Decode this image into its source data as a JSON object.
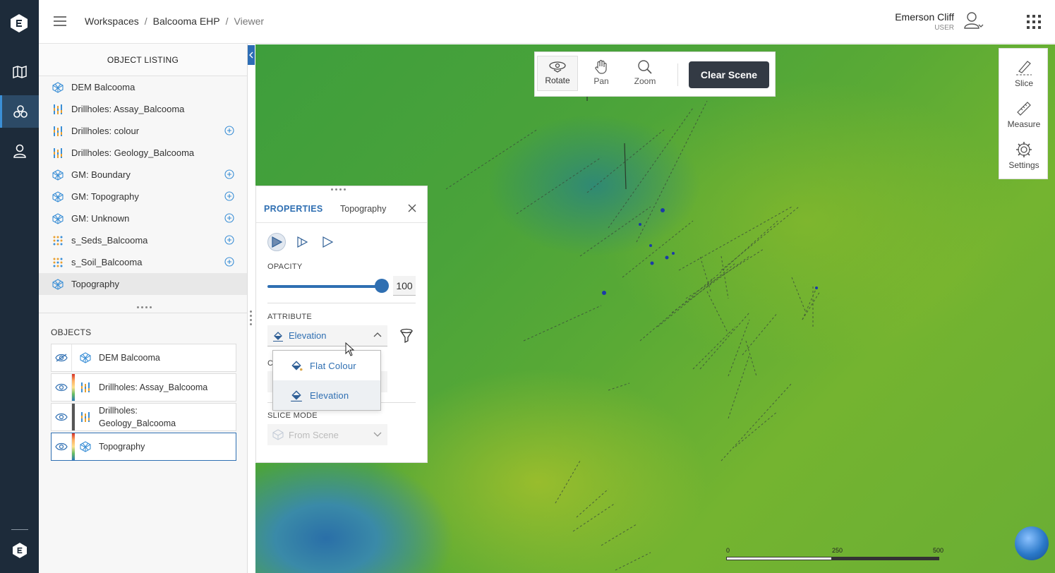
{
  "breadcrumb": {
    "workspaces": "Workspaces",
    "project": "Balcooma EHP",
    "page": "Viewer",
    "separator": "/"
  },
  "user": {
    "name": "Emerson Cliff",
    "role": "USER"
  },
  "object_listing": {
    "title": "OBJECT LISTING",
    "items": [
      {
        "label": "DEM Balcooma",
        "icon": "mesh-icon",
        "add": false,
        "selected": false
      },
      {
        "label": "Drillholes: Assay_Balcooma",
        "icon": "drillhole-icon",
        "add": false,
        "selected": false
      },
      {
        "label": "Drillholes: colour",
        "icon": "drillhole-icon",
        "add": true,
        "selected": false
      },
      {
        "label": "Drillholes: Geology_Balcooma",
        "icon": "drillhole-icon",
        "add": false,
        "selected": false
      },
      {
        "label": "GM: Boundary",
        "icon": "mesh-icon",
        "add": true,
        "selected": false
      },
      {
        "label": "GM: Topography",
        "icon": "mesh-icon",
        "add": true,
        "selected": false
      },
      {
        "label": "GM: Unknown",
        "icon": "mesh-icon",
        "add": true,
        "selected": false
      },
      {
        "label": "s_Seds_Balcooma",
        "icon": "points-icon",
        "add": true,
        "selected": false
      },
      {
        "label": "s_Soil_Balcooma",
        "icon": "points-icon",
        "add": true,
        "selected": false
      },
      {
        "label": "Topography",
        "icon": "mesh-icon",
        "add": false,
        "selected": true
      }
    ]
  },
  "objects": {
    "title": "OBJECTS",
    "items": [
      {
        "label": "DEM Balcooma",
        "icon": "mesh-icon",
        "visible": false,
        "bar": "none"
      },
      {
        "label": "Drillholes: Assay_Balcooma",
        "icon": "drillhole-icon",
        "visible": true,
        "bar": "gradient"
      },
      {
        "label_line1": "Drillholes:",
        "label_line2": "Geology_Balcooma",
        "icon": "drillhole-icon",
        "visible": true,
        "bar": "dark"
      },
      {
        "label": "Topography",
        "icon": "mesh-icon",
        "visible": true,
        "bar": "gradient",
        "selected": true
      }
    ]
  },
  "toolbar": {
    "rotate": "Rotate",
    "pan": "Pan",
    "zoom": "Zoom",
    "clear": "Clear Scene"
  },
  "right_tools": {
    "slice": "Slice",
    "measure": "Measure",
    "settings": "Settings"
  },
  "properties": {
    "tab": "PROPERTIES",
    "object_name": "Topography",
    "opacity_label": "OPACITY",
    "opacity_value": "100",
    "attribute_label": "ATTRIBUTE",
    "attribute_value": "Elevation",
    "ghost_label": "C",
    "slice_mode_label": "SLICE MODE",
    "slice_mode_value": "From Scene"
  },
  "attribute_dropdown": {
    "options": [
      "Flat Colour",
      "Elevation"
    ],
    "selected": "Elevation"
  },
  "scalebar": {
    "labels": [
      "0",
      "250",
      "500"
    ]
  },
  "colors": {
    "accent": "#2f6fb2",
    "rail": "#1d2b3a",
    "clear_button": "#333a44"
  }
}
